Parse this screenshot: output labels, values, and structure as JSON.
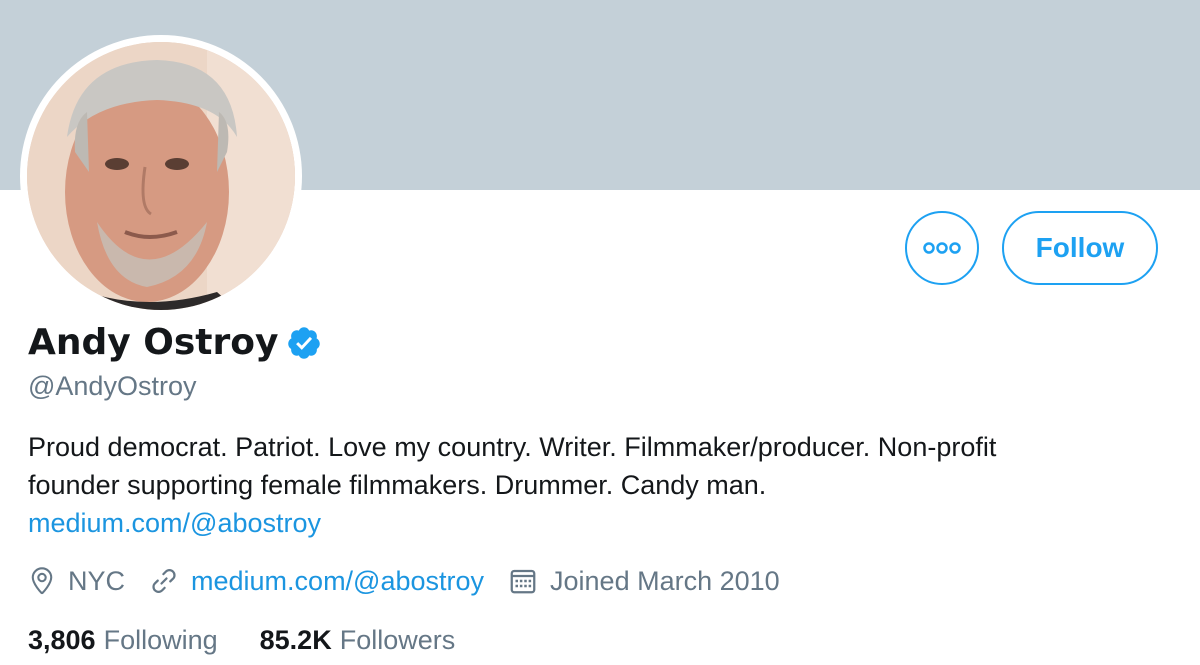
{
  "profile": {
    "name": "Andy Ostroy",
    "handle": "@AndyOstroy",
    "bio_text_line1": "Proud democrat. Patriot. Love my country. Writer. Filmmaker/producer. Non-profit",
    "bio_text_line2": "founder supporting female filmmakers. Drummer. Candy man.",
    "bio_link": "medium.com/@abostroy",
    "verified": true
  },
  "actions": {
    "follow_label": "Follow",
    "more_icon": "more-dots-icon"
  },
  "meta": {
    "location": "NYC",
    "website": "medium.com/@abostroy",
    "joined": "Joined March 2010"
  },
  "stats": {
    "following_count": "3,806",
    "following_label": "Following",
    "followers_count": "85.2K",
    "followers_label": "Followers"
  },
  "colors": {
    "banner": "#c4d0d8",
    "accent": "#1da1f2",
    "link": "#1b95e0",
    "muted": "#657786",
    "text": "#14171a"
  }
}
